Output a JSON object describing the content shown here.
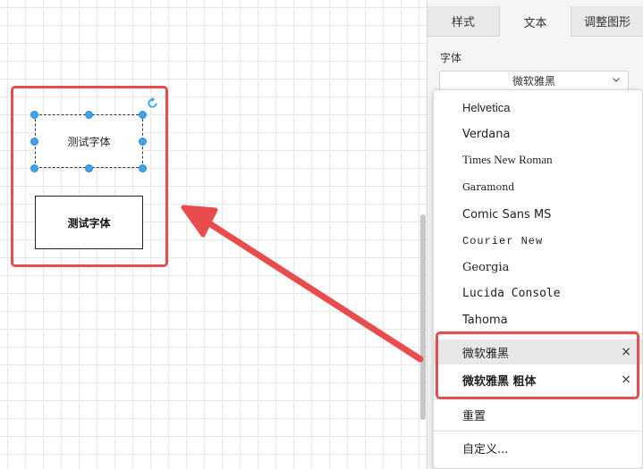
{
  "canvas": {
    "shape_selected_text": "测试字体",
    "shape_bold_text": "测试字体"
  },
  "panel": {
    "tabs": [
      {
        "label": "样式"
      },
      {
        "label": "文本"
      },
      {
        "label": "调整图形"
      }
    ],
    "font_label": "字体",
    "font_value": "微软雅黑"
  },
  "dropdown": {
    "items": [
      {
        "label": "Helvetica"
      },
      {
        "label": "Verdana"
      },
      {
        "label": "Times New Roman"
      },
      {
        "label": "Garamond"
      },
      {
        "label": "Comic Sans MS"
      },
      {
        "label": "Courier New"
      },
      {
        "label": "Georgia"
      },
      {
        "label": "Lucida Console"
      },
      {
        "label": "Tahoma"
      }
    ],
    "custom_fonts": [
      {
        "label": "微软雅黑",
        "remove": "×"
      },
      {
        "label": "微软雅黑 粗体",
        "remove": "×"
      }
    ],
    "reset_label": "重置",
    "custom_label": "自定义..."
  },
  "colors": {
    "highlight": "#e84c4c",
    "handle": "#3ea3ea"
  }
}
